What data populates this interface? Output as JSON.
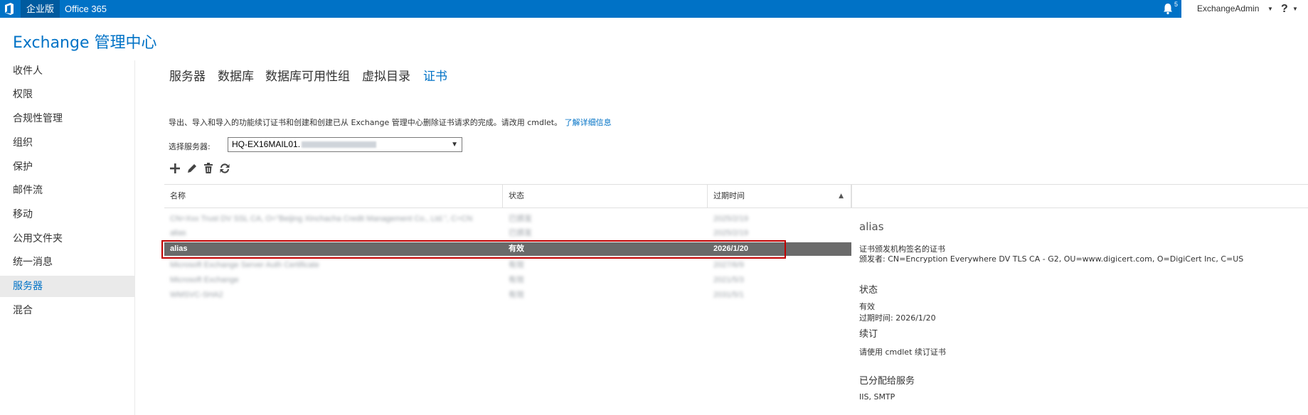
{
  "topbar": {
    "enterprise_label": "企业版",
    "office365_label": "Office 365",
    "notification_count": "5",
    "user_name": "ExchangeAdmin",
    "help_label": "?"
  },
  "app_title": "Exchange 管理中心",
  "sidebar": {
    "items": [
      {
        "label": "收件人"
      },
      {
        "label": "权限"
      },
      {
        "label": "合规性管理"
      },
      {
        "label": "组织"
      },
      {
        "label": "保护"
      },
      {
        "label": "邮件流"
      },
      {
        "label": "移动"
      },
      {
        "label": "公用文件夹"
      },
      {
        "label": "统一消息"
      },
      {
        "label": "服务器",
        "active": true
      },
      {
        "label": "混合"
      }
    ]
  },
  "tabs": [
    {
      "label": "服务器"
    },
    {
      "label": "数据库"
    },
    {
      "label": "数据库可用性组"
    },
    {
      "label": "虚拟目录"
    },
    {
      "label": "证书",
      "active": true
    }
  ],
  "description": {
    "text": "导出、导入和导入的功能续订证书和创建和创建已从 Exchange 管理中心删除证书请求的完成。请改用 cmdlet。",
    "link": "了解详细信息"
  },
  "server_select": {
    "label": "选择服务器:",
    "value": "HQ-EX16MAIL01."
  },
  "toolbar": {
    "icons": [
      "add-icon",
      "edit-icon",
      "delete-icon",
      "refresh-icon"
    ]
  },
  "table": {
    "columns": [
      "名称",
      "状态",
      "过期时间"
    ],
    "sort_column": "过期时间",
    "rows": [
      {
        "name": "CN=Xxx Trust DV SSL CA, O=\"Beijing Xinchacha Credit Management Co., Ltd.\", C=CN",
        "status": "已颁发",
        "expires": "2025/2/19",
        "blurred": true
      },
      {
        "name": "alias",
        "status": "已颁发",
        "expires": "2025/2/19",
        "blurred": true
      },
      {
        "name": "alias",
        "status": "有效",
        "expires": "2026/1/20",
        "selected": true
      },
      {
        "name": "Microsoft Exchange Server Auth Certificate",
        "status": "有效",
        "expires": "2027/6/9",
        "blurred": true
      },
      {
        "name": "Microsoft Exchange",
        "status": "有效",
        "expires": "2021/5/3",
        "blurred": true
      },
      {
        "name": "WMSVC-SHA2",
        "status": "有效",
        "expires": "2031/5/1",
        "blurred": true
      }
    ]
  },
  "details": {
    "title": "alias",
    "issuer_type": "证书颁发机构签名的证书",
    "issuer": "颁发者: CN=Encryption Everywhere DV TLS CA - G2, OU=www.digicert.com, O=DigiCert Inc, C=US",
    "status_heading": "状态",
    "status_value": "有效",
    "expiry": "过期时间: 2026/1/20",
    "renew_heading": "续订",
    "renew_text": "请使用 cmdlet 续订证书",
    "services_heading": "已分配给服务",
    "services_value": "IIS, SMTP"
  },
  "colors": {
    "brand": "#0072c6",
    "selection": "#6a6a6a",
    "highlight": "#c00000"
  }
}
